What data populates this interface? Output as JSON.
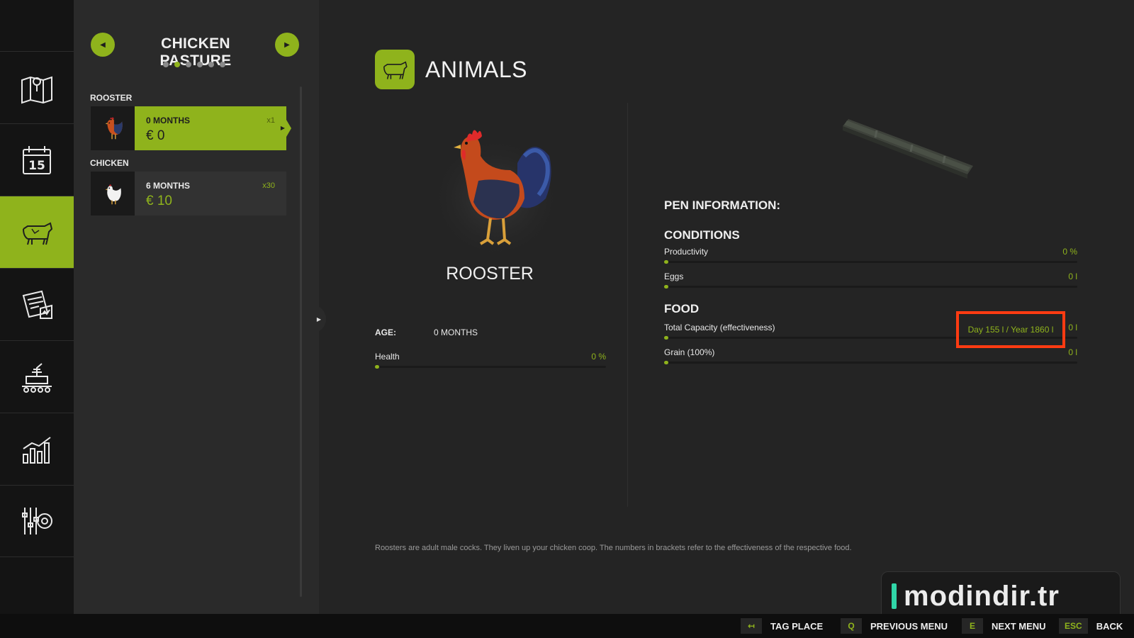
{
  "sidebar": {
    "items": [
      {
        "icon": "map-icon"
      },
      {
        "icon": "calendar-icon",
        "text": "15"
      },
      {
        "icon": "cow-icon",
        "active": true
      },
      {
        "icon": "contracts-icon"
      },
      {
        "icon": "production-icon"
      },
      {
        "icon": "statistics-icon"
      },
      {
        "icon": "settings-icon"
      }
    ]
  },
  "list": {
    "title": "CHICKEN PASTURE",
    "page_dots": 6,
    "active_dot": 1,
    "categories": [
      {
        "label": "ROOSTER",
        "age": "0 MONTHS",
        "price": "€ 0",
        "count": "x1",
        "selected": true
      },
      {
        "label": "CHICKEN",
        "age": "6 MONTHS",
        "price": "€ 10",
        "count": "x30",
        "selected": false
      }
    ]
  },
  "main": {
    "title": "ANIMALS",
    "animal_name": "ROOSTER",
    "age_label": "AGE:",
    "age_value": "0 MONTHS",
    "health_label": "Health",
    "health_value": "0 %",
    "health_fraction": 0,
    "pen_info": "PEN INFORMATION:",
    "conditions_heading": "CONDITIONS",
    "productivity_label": "Productivity",
    "productivity_value": "0 %",
    "eggs_label": "Eggs",
    "eggs_value": "0 l",
    "food_heading": "FOOD",
    "capacity_label": "Total Capacity (effectiveness)",
    "capacity_detail": "Day 155 l / Year 1860 l",
    "capacity_value": "0 l",
    "grain_label": "Grain (100%)",
    "grain_value": "0 l",
    "description": "Roosters are adult male cocks. They liven up your chicken coop. The numbers in brackets refer to the effectiveness of the respective food."
  },
  "watermark": "modindir.tr",
  "hints": [
    {
      "key": "↤",
      "action": "TAG PLACE"
    },
    {
      "key": "Q",
      "action": "PREVIOUS MENU"
    },
    {
      "key": "E",
      "action": "NEXT MENU"
    },
    {
      "key": "ESC",
      "action": "BACK"
    }
  ],
  "colors": {
    "accent": "#8fb31c",
    "highlight": "#ff3b12",
    "panel": "#2a2a2a",
    "background": "#242424"
  }
}
